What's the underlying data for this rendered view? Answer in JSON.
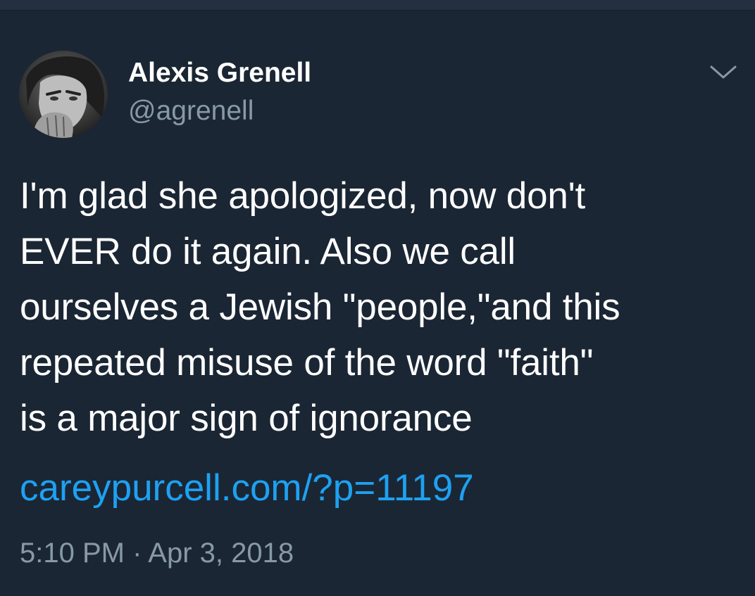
{
  "tweet": {
    "author": {
      "display_name": "Alexis Grenell",
      "handle": "@agrenell",
      "avatar_icon": "user-avatar-photo"
    },
    "menu_icon": "chevron-down-icon",
    "text": "I'm glad she apologized, now don't\nEVER do it again. Also we call\nourselves a Jewish \"people,\"and this\nrepeated misuse of the word \"faith\"\nis a major sign of ignorance",
    "link": "careypurcell.com/?p=11197",
    "timestamp": "5:10 PM · Apr 3, 2018"
  },
  "colors": {
    "background": "#1b2634",
    "text_primary": "#ffffff",
    "text_secondary": "#8899a6",
    "link": "#1da1f2"
  }
}
